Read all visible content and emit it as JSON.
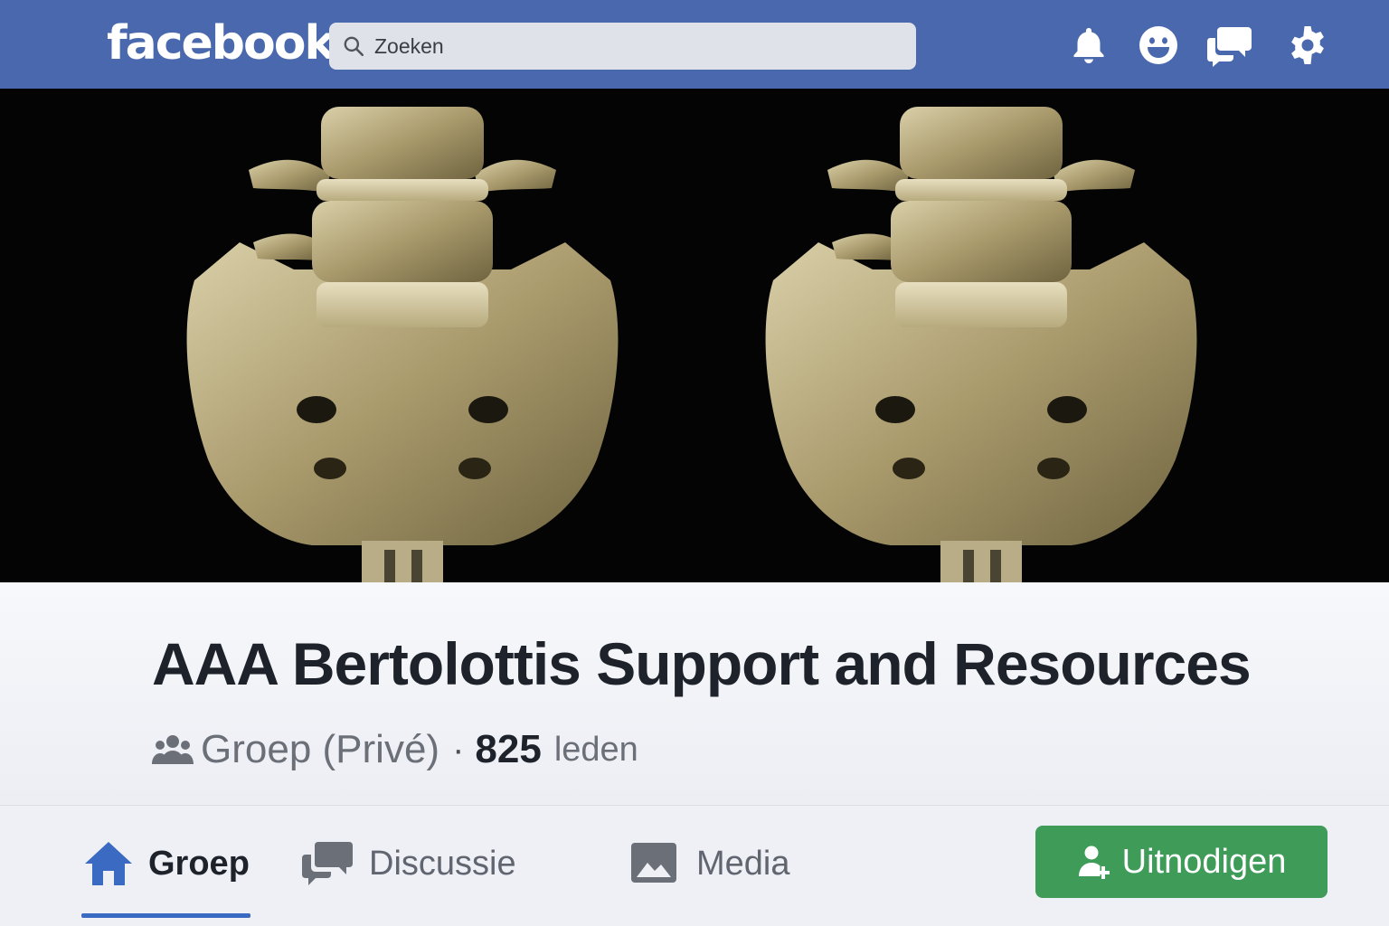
{
  "topbar": {
    "logo": "facebook",
    "search": {
      "placeholder": "Zoeken"
    },
    "icons": [
      "bell-icon",
      "smiley-icon",
      "messages-icon",
      "gear-icon"
    ],
    "color": "#4a68ad"
  },
  "cover": {
    "description_icon": "spine-image"
  },
  "group": {
    "title": "AAA Bertolottis Support and Resources",
    "type": "Groep (Privé)",
    "separator": "·",
    "member_count": "825",
    "member_label": "leden"
  },
  "tabs": [
    {
      "label": "Groep",
      "icon": "home-icon",
      "active": true
    },
    {
      "label": "Discussie",
      "icon": "chat-icon",
      "active": false
    },
    {
      "label": "Media",
      "icon": "image-icon",
      "active": false
    }
  ],
  "invite": {
    "label": "Uitnodigen",
    "icon": "add-person-icon",
    "color": "#3f9b58"
  },
  "accent": "#3b6ac2"
}
